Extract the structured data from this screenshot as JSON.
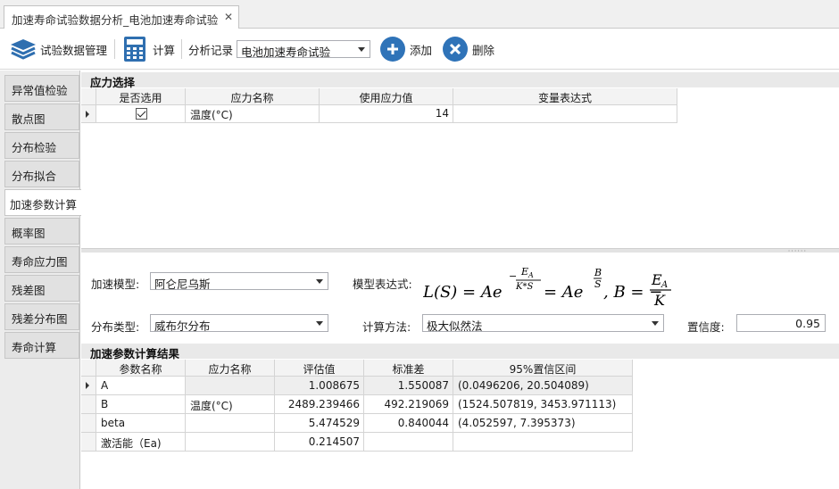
{
  "window": {
    "tab_title": "加速寿命试验数据分析_电池加速寿命试验",
    "tab_close": "✕"
  },
  "toolbar": {
    "data_mgmt_label": "试验数据管理",
    "calc_label": "计算",
    "record_label": "分析记录",
    "record_value": "电池加速寿命试验",
    "add_label": "添加",
    "delete_label": "删除"
  },
  "sidebar": {
    "items": [
      {
        "label": "异常值检验"
      },
      {
        "label": "散点图"
      },
      {
        "label": "分布检验"
      },
      {
        "label": "分布拟合"
      },
      {
        "label": "加速参数计算",
        "active": true
      },
      {
        "label": "概率图"
      },
      {
        "label": "寿命应力图"
      },
      {
        "label": "残差图"
      },
      {
        "label": "残差分布图"
      },
      {
        "label": "寿命计算"
      }
    ]
  },
  "stress": {
    "title": "应力选择",
    "columns": [
      "是否选用",
      "应力名称",
      "使用应力值",
      "变量表达式"
    ],
    "rows": [
      {
        "selected": true,
        "name": "温度(°C)",
        "value": "14",
        "expression": ""
      }
    ]
  },
  "params": {
    "model_label": "加速模型:",
    "model_value": "阿仑尼乌斯",
    "expr_label": "模型表达式:",
    "dist_label": "分布类型:",
    "dist_value": "威布尔分布",
    "method_label": "计算方法:",
    "method_value": "极大似然法",
    "conf_label": "置信度:",
    "conf_value": "0.95"
  },
  "formula": {
    "lhs": "L(S) = Ae",
    "exp1_num": "E",
    "exp1_num_sub": "A",
    "exp1_den": "K*S",
    "mid": "= Ae",
    "exp2_num": "B",
    "exp2_den": "S",
    "tail": ", B = −",
    "frac_num": "E",
    "frac_num_sub": "A",
    "frac_den": "K",
    "minus": "−"
  },
  "results": {
    "title": "加速参数计算结果",
    "columns": [
      "参数名称",
      "应力名称",
      "评估值",
      "标准差",
      "95%置信区间"
    ],
    "rows": [
      {
        "param": "A",
        "stress": "",
        "estimate": "1.008675",
        "std": "1.550087",
        "ci": "(0.0496206, 20.504089)"
      },
      {
        "param": "B",
        "stress": "温度(°C)",
        "estimate": "2489.239466",
        "std": "492.219069",
        "ci": "(1524.507819, 3453.971113)"
      },
      {
        "param": "beta",
        "stress": "",
        "estimate": "5.474529",
        "std": "0.840044",
        "ci": "(4.052597, 7.395373)"
      },
      {
        "param": "激活能（Ea)",
        "stress": "",
        "estimate": "0.214507",
        "std": "",
        "ci": ""
      }
    ]
  },
  "colors": {
    "accent_blue": "#2f73b8",
    "sidebar_bg": "#ececec",
    "section_bg": "#e9e9e9"
  }
}
